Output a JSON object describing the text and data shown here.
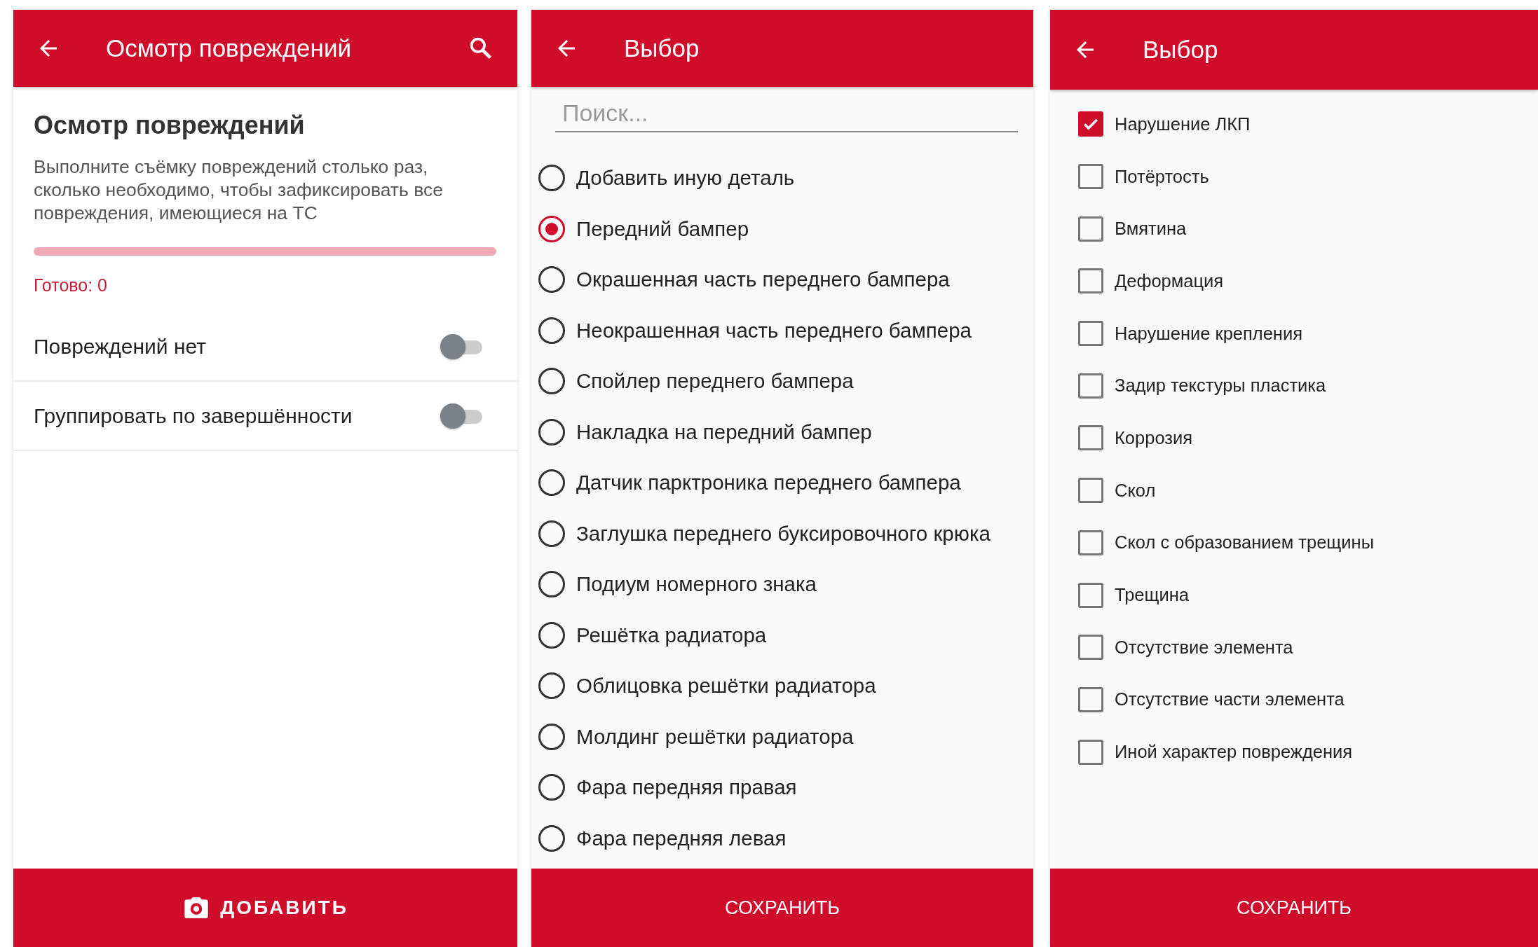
{
  "inspection_screen": {
    "title": "Осмотр повреждений",
    "heading": "Осмотр повреждений",
    "description": "Выполните съёмку повреждений столько раз, сколько необходимо, чтобы зафиксировать все повреждения, имеющиеся на ТС",
    "progress": {
      "level": 0
    },
    "status": "Готово: 0",
    "toggles": [
      {
        "label": "Повреждений нет",
        "on": false
      },
      {
        "label": "Группировать по завершённости",
        "on": false
      }
    ],
    "action_button": "ДОБАВИТЬ"
  },
  "part_screen": {
    "title": "Выбор",
    "search": {
      "placeholder": "Поиск..."
    },
    "options": [
      {
        "label": "Добавить иную деталь",
        "selected": false
      },
      {
        "label": "Передний бампер",
        "selected": true
      },
      {
        "label": "Окрашенная часть переднего бампера",
        "selected": false
      },
      {
        "label": "Неокрашенная часть переднего бампера",
        "selected": false
      },
      {
        "label": "Спойлер переднего бампера",
        "selected": false
      },
      {
        "label": "Накладка на передний бампер",
        "selected": false
      },
      {
        "label": "Датчик парктроника переднего бампера",
        "selected": false
      },
      {
        "label": "Заглушка переднего буксировочного крюка",
        "selected": false
      },
      {
        "label": "Подиум номерного знака",
        "selected": false
      },
      {
        "label": "Решётка радиатора",
        "selected": false
      },
      {
        "label": "Облицовка решётки радиатора",
        "selected": false
      },
      {
        "label": "Молдинг решётки радиатора",
        "selected": false
      },
      {
        "label": "Фара передняя правая",
        "selected": false
      },
      {
        "label": "Фара передняя левая",
        "selected": false
      }
    ],
    "save_button": "СОХРАНИТЬ"
  },
  "damage_screen": {
    "title": "Выбор",
    "options": [
      {
        "label": "Нарушение ЛКП",
        "checked": true
      },
      {
        "label": "Потёртость",
        "checked": false
      },
      {
        "label": "Вмятина",
        "checked": false
      },
      {
        "label": "Деформация",
        "checked": false
      },
      {
        "label": "Нарушение крепления",
        "checked": false
      },
      {
        "label": "Задир текстуры пластика",
        "checked": false
      },
      {
        "label": "Коррозия",
        "checked": false
      },
      {
        "label": "Скол",
        "checked": false
      },
      {
        "label": "Скол с образованием трещины",
        "checked": false
      },
      {
        "label": "Трещина",
        "checked": false
      },
      {
        "label": "Отсутствие элемента",
        "checked": false
      },
      {
        "label": "Отсутствие части элемента",
        "checked": false
      },
      {
        "label": "Иной характер повреждения",
        "checked": false
      }
    ],
    "save_button": "СОХРАНИТЬ"
  }
}
